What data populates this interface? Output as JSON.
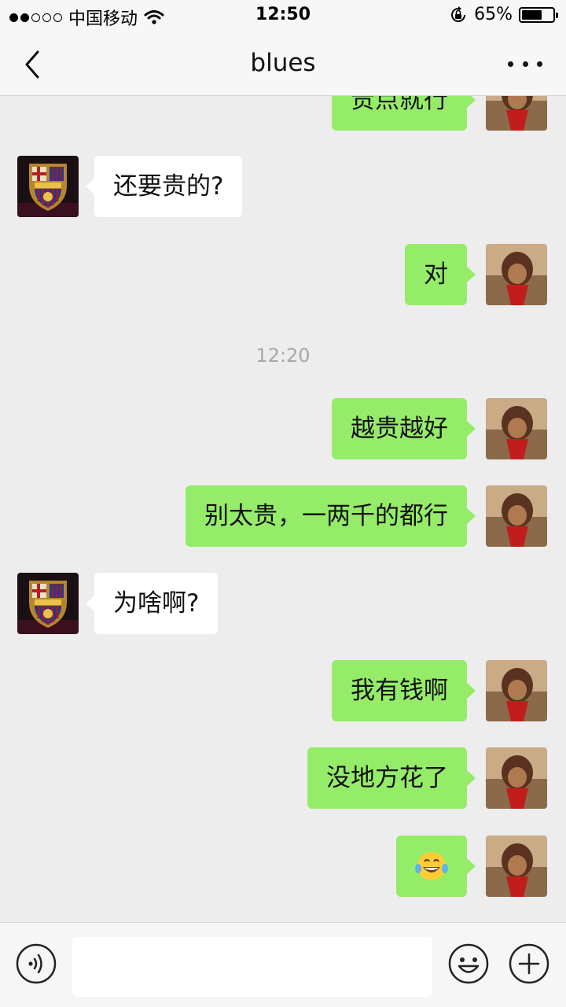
{
  "status_bar": {
    "carrier": "中国移动",
    "time": "12:50",
    "battery": "65%",
    "battery_level": 0.65,
    "signal_bars": 2
  },
  "nav": {
    "title": "blues"
  },
  "messages": [
    {
      "side": "me",
      "text": "贵点就行"
    },
    {
      "side": "peer",
      "text": "还要贵的?"
    },
    {
      "side": "me",
      "text": "对"
    },
    {
      "timestamp": "12:20"
    },
    {
      "side": "me",
      "text": "越贵越好"
    },
    {
      "side": "me",
      "text": "别太贵，一两千的都行"
    },
    {
      "side": "peer",
      "text": "为啥啊?"
    },
    {
      "side": "me",
      "text": "我有钱啊"
    },
    {
      "side": "me",
      "text": "没地方花了"
    },
    {
      "side": "me",
      "text": "😂",
      "icon": "tears-of-joy-emoji"
    }
  ],
  "input_bar": {
    "text_value": "",
    "icons": [
      "voice-icon",
      "emoji-icon",
      "plus-icon"
    ]
  },
  "colors": {
    "my_bubble": "#95ec69",
    "peer_bubble": "#ffffff",
    "background": "#ededed"
  }
}
